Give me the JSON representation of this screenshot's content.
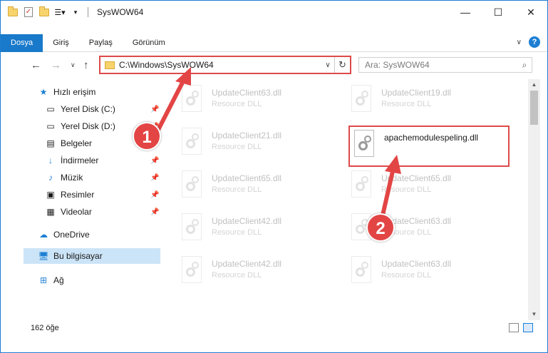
{
  "window": {
    "title": "SysWOW64",
    "controls": {
      "minimize": "—",
      "maximize": "☐",
      "close": "✕"
    }
  },
  "ribbon": {
    "tabs": [
      "Dosya",
      "Giriş",
      "Paylaş",
      "Görünüm"
    ],
    "active_tab": 0,
    "help": "?"
  },
  "address_bar": {
    "path": "C:\\Windows\\SysWOW64",
    "dropdown": "∨",
    "refresh": "↻"
  },
  "search": {
    "placeholder": "Ara: SysWOW64"
  },
  "sidebar": {
    "quick_access": "Hızlı erişim",
    "items": [
      {
        "label": "Yerel Disk (C:)",
        "icon": "drive-icon",
        "pinned": true
      },
      {
        "label": "Yerel Disk (D:)",
        "icon": "drive-icon",
        "pinned": true
      },
      {
        "label": "Belgeler",
        "icon": "documents-icon",
        "pinned": true
      },
      {
        "label": "İndirmeler",
        "icon": "downloads-icon",
        "pinned": true
      },
      {
        "label": "Müzik",
        "icon": "music-icon",
        "pinned": true
      },
      {
        "label": "Resimler",
        "icon": "pictures-icon",
        "pinned": true
      },
      {
        "label": "Videolar",
        "icon": "videos-icon",
        "pinned": true
      }
    ],
    "onedrive": "OneDrive",
    "this_pc": "Bu bilgisayar",
    "network": "Ağ"
  },
  "files": {
    "left_column": [
      {
        "name": "UpdateClient63.dll",
        "type": "Resource DLL"
      },
      {
        "name": "UpdateClient21.dll",
        "type": "Resource DLL"
      },
      {
        "name": "UpdateClient65.dll",
        "type": "Resource DLL"
      },
      {
        "name": "UpdateClient42.dll",
        "type": "Resource DLL"
      },
      {
        "name": "UpdateClient42.dll",
        "type": "Resource DLL"
      }
    ],
    "right_column": [
      {
        "name": "UpdateClient19.dll",
        "type": "Resource DLL"
      },
      {
        "name": "apachemodulespeling.dll",
        "type": ""
      },
      {
        "name": "UpdateClient65.dll",
        "type": "Resource DLL"
      },
      {
        "name": "UpdateClient63.dll",
        "type": "Resource DLL"
      },
      {
        "name": "UpdateClient63.dll",
        "type": "Resource DLL"
      }
    ]
  },
  "status": {
    "count": "162 öğe"
  },
  "annotations": {
    "step1": "1",
    "step2": "2",
    "color": "#e34545"
  }
}
